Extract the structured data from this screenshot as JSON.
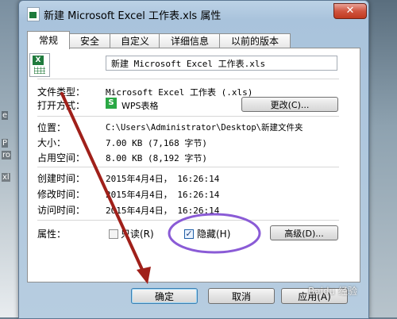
{
  "dialog": {
    "title": "新建 Microsoft Excel 工作表.xls 属性",
    "close_glyph": "✕",
    "tabs": [
      {
        "label": "常规",
        "active": true
      },
      {
        "label": "安全",
        "active": false
      },
      {
        "label": "自定义",
        "active": false
      },
      {
        "label": "详细信息",
        "active": false
      },
      {
        "label": "以前的版本",
        "active": false
      }
    ],
    "filename": "新建 Microsoft Excel 工作表.xls",
    "file_type_label": "文件类型：",
    "file_type_value": "Microsoft Excel 工作表 (.xls)",
    "open_with_label": "打开方式：",
    "open_with_icon_glyph": "S",
    "open_with_value": "WPS表格",
    "change_button": "更改(C)...",
    "location_label": "位置：",
    "location_value": "C:\\Users\\Administrator\\Desktop\\新建文件夹",
    "size_label": "大小：",
    "size_value": "7.00 KB (7,168 字节)",
    "size_on_disk_label": "占用空间：",
    "size_on_disk_value": "8.00 KB (8,192 字节)",
    "created_label": "创建时间：",
    "created_value": "2015年4月4日， 16:26:14",
    "modified_label": "修改时间：",
    "modified_value": "2015年4月4日， 16:26:14",
    "accessed_label": "访问时间：",
    "accessed_value": "2015年4月4日， 16:26:14",
    "attributes_label": "属性：",
    "readonly_label": "只读(R)",
    "readonly_checked": false,
    "hidden_label": "隐藏(H)",
    "hidden_checked": true,
    "check_glyph": "✓",
    "advanced_button": "高级(D)...",
    "ok_button": "确定",
    "cancel_button": "取消",
    "apply_button": "应用(A)"
  },
  "background": {
    "left_fragments": [
      "e",
      "P",
      "ro",
      "xl"
    ]
  },
  "watermark": "Baidu 经验",
  "colors": {
    "annotation_arrow": "#a0201a",
    "annotation_circle": "#8a5bd6",
    "excel_green": "#1f7b3d",
    "wps_green": "#2aa845"
  }
}
